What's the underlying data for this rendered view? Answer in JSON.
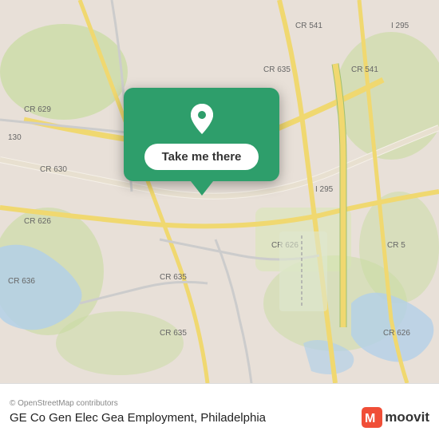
{
  "map": {
    "attribution": "© OpenStreetMap contributors",
    "background_color": "#e8e0d8"
  },
  "tooltip": {
    "button_label": "Take me there",
    "pin_color": "#ffffff",
    "background_color": "#2e9e6b"
  },
  "bottom_bar": {
    "location_title": "GE Co Gen Elec Gea Employment, Philadelphia",
    "attribution": "© OpenStreetMap contributors",
    "moovit_label": "moovit"
  }
}
